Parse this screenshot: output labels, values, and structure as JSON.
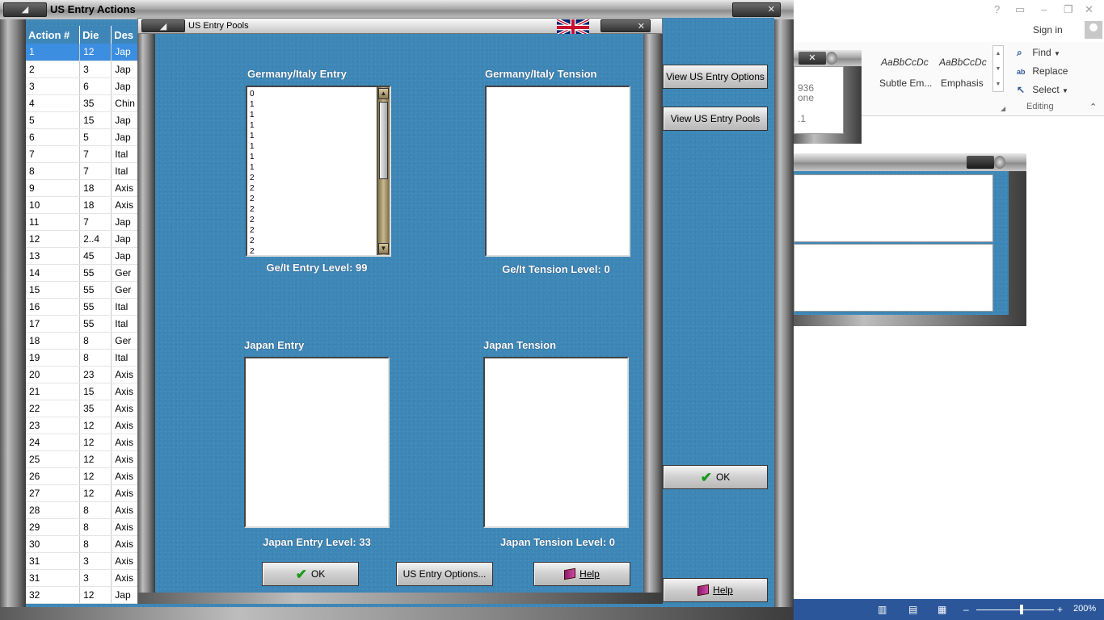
{
  "actions_window": {
    "title": "US Entry Actions",
    "columns": [
      "Action #",
      "Die",
      "Des"
    ],
    "rows": [
      {
        "action": "1",
        "die": "12",
        "desc": "Jap"
      },
      {
        "action": "2",
        "die": "3",
        "desc": "Jap"
      },
      {
        "action": "3",
        "die": "6",
        "desc": "Jap"
      },
      {
        "action": "4",
        "die": "35",
        "desc": "Chin"
      },
      {
        "action": "5",
        "die": "15",
        "desc": "Jap"
      },
      {
        "action": "6",
        "die": "5",
        "desc": "Jap"
      },
      {
        "action": "7",
        "die": "7",
        "desc": "Ital"
      },
      {
        "action": "8",
        "die": "7",
        "desc": "Ital"
      },
      {
        "action": "9",
        "die": "18",
        "desc": "Axis"
      },
      {
        "action": "10",
        "die": "18",
        "desc": "Axis"
      },
      {
        "action": "11",
        "die": "7",
        "desc": "Jap"
      },
      {
        "action": "12",
        "die": "2..4",
        "desc": "Jap"
      },
      {
        "action": "13",
        "die": "45",
        "desc": "Jap"
      },
      {
        "action": "14",
        "die": "55",
        "desc": "Ger"
      },
      {
        "action": "15",
        "die": "55",
        "desc": "Ger"
      },
      {
        "action": "16",
        "die": "55",
        "desc": "Ital"
      },
      {
        "action": "17",
        "die": "55",
        "desc": "Ital"
      },
      {
        "action": "18",
        "die": "8",
        "desc": "Ger"
      },
      {
        "action": "19",
        "die": "8",
        "desc": "Ital"
      },
      {
        "action": "20",
        "die": "23",
        "desc": "Axis"
      },
      {
        "action": "21",
        "die": "15",
        "desc": "Axis"
      },
      {
        "action": "22",
        "die": "35",
        "desc": "Axis"
      },
      {
        "action": "23",
        "die": "12",
        "desc": "Axis"
      },
      {
        "action": "24",
        "die": "12",
        "desc": "Axis"
      },
      {
        "action": "25",
        "die": "12",
        "desc": "Axis"
      },
      {
        "action": "26",
        "die": "12",
        "desc": "Axis"
      },
      {
        "action": "27",
        "die": "12",
        "desc": "Axis"
      },
      {
        "action": "28",
        "die": "8",
        "desc": "Axis"
      },
      {
        "action": "29",
        "die": "8",
        "desc": "Axis"
      },
      {
        "action": "30",
        "die": "8",
        "desc": "Axis"
      },
      {
        "action": "31",
        "die": "3",
        "desc": "Axis"
      },
      {
        "action": "31",
        "die": "3",
        "desc": "Axis"
      },
      {
        "action": "32",
        "die": "12",
        "desc": "Jap"
      }
    ],
    "selected_row": 0,
    "side_buttons": {
      "view_options": "View US Entry Options",
      "view_pools": "View US Entry Pools",
      "ok": "OK",
      "help": "Help"
    }
  },
  "pools_dialog": {
    "title": "US Entry Pools",
    "ge_it_entry": {
      "title": "Germany/Italy Entry",
      "items": [
        "0",
        "1",
        "1",
        "1",
        "1",
        "1",
        "1",
        "1",
        "2",
        "2",
        "2",
        "2",
        "2",
        "2",
        "2",
        "2"
      ],
      "level_label": "Ge/It Entry Level: 99"
    },
    "ge_it_tension": {
      "title": "Germany/Italy Tension",
      "items": [],
      "level_label": "Ge/It Tension Level: 0"
    },
    "japan_entry": {
      "title": "Japan Entry",
      "items": [],
      "level_label": "Japan Entry Level: 33"
    },
    "japan_tension": {
      "title": "Japan Tension",
      "items": [],
      "level_label": "Japan Tension Level: 0"
    },
    "buttons": {
      "ok": "OK",
      "options": "US Entry Options...",
      "help": "Help"
    }
  },
  "word": {
    "controls": [
      "?",
      "▭",
      "–",
      "❐",
      "✕"
    ],
    "sign_in": "Sign in",
    "styles": [
      {
        "preview": "AaBbCcDc",
        "name": "Subtle Em..."
      },
      {
        "preview": "AaBbCcDc",
        "name": "Emphasis"
      }
    ],
    "editing": {
      "find": "Find",
      "replace": "Replace",
      "select": "Select",
      "group_label": "Editing"
    },
    "behind_text": [
      "936",
      "one",
      ".1"
    ],
    "zoom_level": "200%"
  },
  "colors": {
    "panel_blue": "#3d87b7",
    "table_header": "#3e86b8",
    "selection": "#3c8ee0",
    "word_blue": "#2b579a"
  }
}
